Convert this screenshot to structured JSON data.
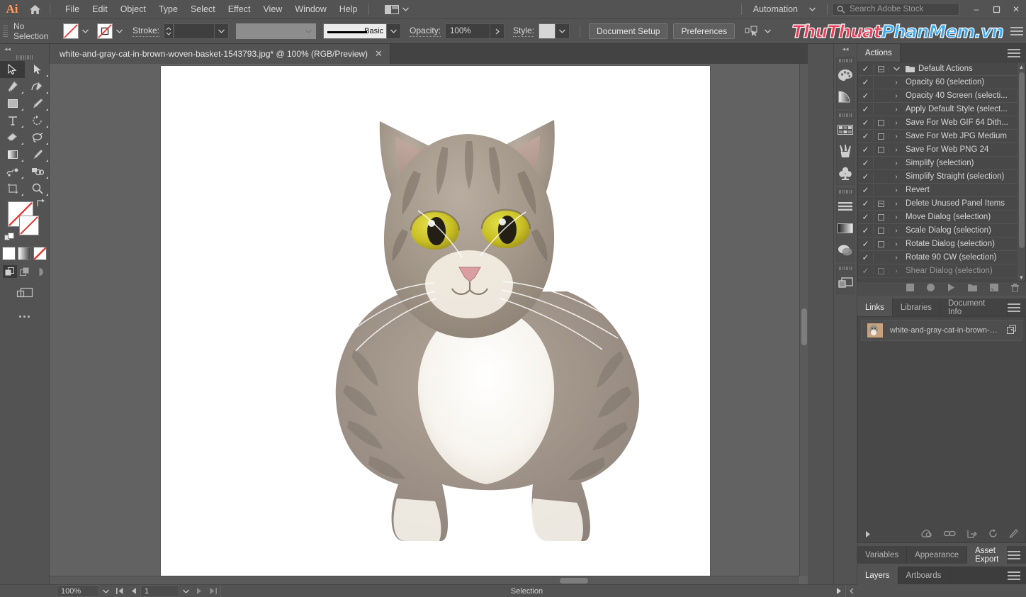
{
  "app": {
    "logo": "Ai",
    "home_icon": "home-icon",
    "menu": [
      "File",
      "Edit",
      "Object",
      "Type",
      "Select",
      "Effect",
      "View",
      "Window",
      "Help"
    ],
    "arrange_icon": "arrange-documents-icon",
    "automation_label": "Automation",
    "search_placeholder": "Search Adobe Stock",
    "window_buttons": {
      "minimize": "–",
      "maximize": "❐",
      "close": "✕"
    }
  },
  "control_bar": {
    "selection_status": "No Selection",
    "fill_label": "fill-swatch-none",
    "stroke_swatch_label": "stroke-swatch-none",
    "stroke_label": "Stroke:",
    "stroke_weight": "",
    "variable_width_profile": "",
    "brush_definition": "Basic",
    "opacity_label": "Opacity:",
    "opacity_value": "100%",
    "style_label": "Style:",
    "document_setup": "Document Setup",
    "preferences": "Preferences",
    "align_icon": "align-to-selection-icon",
    "watermark": {
      "part1": "ThuThuat",
      "part2": "PhanMem.vn"
    },
    "panel_menu_icon": "panel-menu-icon"
  },
  "toolbar": {
    "collapse_icon": "collapse-panel-icon",
    "tools": [
      {
        "name": "selection-tool",
        "glyph": "cursor",
        "active": true
      },
      {
        "name": "direct-selection-tool",
        "glyph": "cursor-white",
        "active": false
      },
      {
        "name": "pen-tool",
        "glyph": "pen",
        "active": false
      },
      {
        "name": "curvature-tool",
        "glyph": "curvature",
        "active": false
      },
      {
        "name": "rectangle-tool",
        "glyph": "rect",
        "active": false
      },
      {
        "name": "paintbrush-tool",
        "glyph": "brush",
        "active": false
      },
      {
        "name": "type-tool",
        "glyph": "type",
        "active": false
      },
      {
        "name": "rotate-tool",
        "glyph": "rotate",
        "active": false
      },
      {
        "name": "eraser-tool",
        "glyph": "eraser",
        "active": false
      },
      {
        "name": "lasso-tool",
        "glyph": "lasso",
        "active": false
      },
      {
        "name": "gradient-tool",
        "glyph": "gradient",
        "active": false
      },
      {
        "name": "eyedropper-tool",
        "glyph": "eyedropper",
        "active": false
      },
      {
        "name": "blend-tool",
        "glyph": "blend",
        "active": false
      },
      {
        "name": "shape-builder-tool",
        "glyph": "shapebuilder",
        "active": false
      },
      {
        "name": "artboard-tool",
        "glyph": "artboard",
        "active": false
      },
      {
        "name": "zoom-tool",
        "glyph": "zoom",
        "active": false
      }
    ],
    "fill_stroke": {
      "fill": "fill-swatch-none",
      "stroke": "stroke-swatch-none",
      "swap_icon": "swap-fill-stroke-icon",
      "default_icon": "default-fill-stroke-icon"
    },
    "color_modes": [
      "color-swatch",
      "gradient-swatch",
      "none-swatch"
    ],
    "draw_modes": [
      "draw-normal",
      "draw-behind",
      "draw-inside"
    ],
    "screen_mode_icon": "change-screen-mode-icon",
    "more_tools_icon": "edit-toolbar-icon"
  },
  "document": {
    "tab_title": "white-and-gray-cat-in-brown-woven-basket-1543793.jpg* @ 100%  (RGB/Preview)",
    "close_icon": "close-tab-icon",
    "artwork_alt": "white-and-gray-cat-cutout"
  },
  "status_bar": {
    "zoom": "100%",
    "first_page_icon": "first-artboard-icon",
    "prev_page_icon": "previous-artboard-icon",
    "page": "1",
    "next_page_icon": "next-artboard-icon",
    "last_page_icon": "last-artboard-icon",
    "status_text": "Selection",
    "play_icon": "play-icon",
    "more_icon": "chevron-left-icon"
  },
  "icon_rail": {
    "collapse_icon": "expand-panels-icon",
    "groups": [
      [
        "color-panel-icon",
        "color-guide-panel-icon"
      ],
      [
        "swatches-panel-icon",
        "brushes-panel-icon",
        "symbols-panel-icon"
      ],
      [
        "align-panel-icon",
        "gradient-panel-icon",
        "transparency-panel-icon"
      ],
      [
        "layers-panel-icon"
      ]
    ]
  },
  "panels": {
    "actions": {
      "tabs": [
        {
          "label": "Actions",
          "active": true
        }
      ],
      "menu_icon": "panel-menu-icon",
      "rows": [
        {
          "checked": true,
          "toggle": "minus",
          "expand": "chevron-down-icon",
          "folder": true,
          "label": "Default Actions"
        },
        {
          "checked": true,
          "toggle": "none",
          "expand": "chevron-right-icon",
          "folder": false,
          "label": "Opacity 60 (selection)"
        },
        {
          "checked": true,
          "toggle": "none",
          "expand": "chevron-right-icon",
          "folder": false,
          "label": "Opacity 40 Screen (selecti..."
        },
        {
          "checked": true,
          "toggle": "none",
          "expand": "chevron-right-icon",
          "folder": false,
          "label": "Apply Default Style (select..."
        },
        {
          "checked": true,
          "toggle": "empty",
          "expand": "chevron-right-icon",
          "folder": false,
          "label": "Save For Web GIF 64 Dith..."
        },
        {
          "checked": true,
          "toggle": "empty",
          "expand": "chevron-right-icon",
          "folder": false,
          "label": "Save For Web JPG Medium"
        },
        {
          "checked": true,
          "toggle": "empty",
          "expand": "chevron-right-icon",
          "folder": false,
          "label": "Save For Web PNG 24"
        },
        {
          "checked": true,
          "toggle": "none",
          "expand": "chevron-right-icon",
          "folder": false,
          "label": "Simplify (selection)"
        },
        {
          "checked": true,
          "toggle": "none",
          "expand": "chevron-right-icon",
          "folder": false,
          "label": "Simplify Straight (selection)"
        },
        {
          "checked": true,
          "toggle": "none",
          "expand": "chevron-right-icon",
          "folder": false,
          "label": "Revert"
        },
        {
          "checked": true,
          "toggle": "minus",
          "expand": "chevron-right-icon",
          "folder": false,
          "label": "Delete Unused Panel Items"
        },
        {
          "checked": true,
          "toggle": "empty",
          "expand": "chevron-right-icon",
          "folder": false,
          "label": "Move Dialog (selection)"
        },
        {
          "checked": true,
          "toggle": "empty",
          "expand": "chevron-right-icon",
          "folder": false,
          "label": "Scale Dialog (selection)"
        },
        {
          "checked": true,
          "toggle": "empty",
          "expand": "chevron-right-icon",
          "folder": false,
          "label": "Rotate Dialog (selection)"
        },
        {
          "checked": true,
          "toggle": "none",
          "expand": "chevron-right-icon",
          "folder": false,
          "label": "Rotate 90 CW (selection)"
        },
        {
          "checked": true,
          "toggle": "empty",
          "expand": "chevron-right-icon",
          "folder": false,
          "label": "Shear Dialog (selection)"
        }
      ],
      "footer_icons": [
        "stop-icon",
        "record-icon",
        "play-icon",
        "new-set-icon",
        "new-action-icon",
        "delete-icon"
      ]
    },
    "links": {
      "tabs": [
        {
          "label": "Links",
          "active": true
        },
        {
          "label": "Libraries",
          "active": false
        },
        {
          "label": "Document Info",
          "active": false
        }
      ],
      "menu_icon": "panel-menu-icon",
      "item_label": "white-and-gray-cat-in-brown-wo...",
      "item_status_icon": "embedded-icon",
      "footer_icons": [
        "relink-from-cc-icon",
        "relink-icon",
        "go-to-link-icon",
        "update-link-icon",
        "edit-original-icon"
      ],
      "expand_icon": "expand-triangle-icon"
    },
    "bottom_docks": [
      {
        "tabs": [
          {
            "label": "Variables",
            "active": false
          },
          {
            "label": "Appearance",
            "active": false
          },
          {
            "label": "Asset Export",
            "active": true
          }
        ],
        "menu_icon": "panel-menu-icon"
      },
      {
        "tabs": [
          {
            "label": "Layers",
            "active": true
          },
          {
            "label": "Artboards",
            "active": false
          }
        ],
        "menu_icon": "panel-menu-icon"
      }
    ]
  },
  "colors": {
    "chrome": "#535353",
    "panel_bg": "#484848",
    "accent_orange": "#ff9a5c",
    "watermark_red": "#ee3b56",
    "watermark_blue": "#3aa9f2",
    "canvas": "#626262"
  }
}
